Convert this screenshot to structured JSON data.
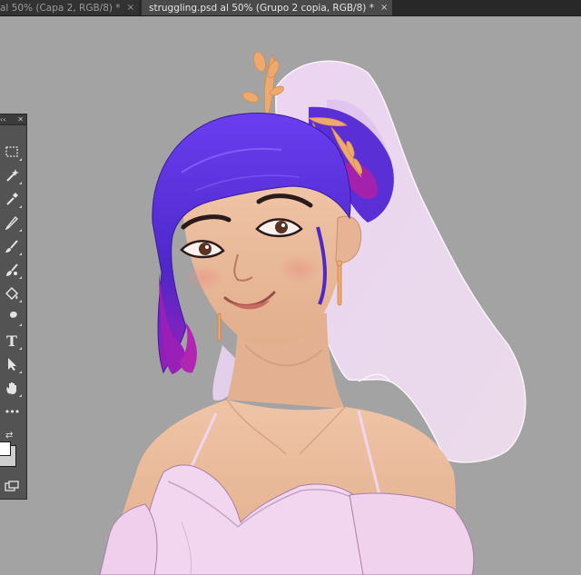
{
  "tabs": [
    {
      "label": "al 50% (Capa 2, RGB/8) *",
      "close": "×",
      "active": false
    },
    {
      "label": "struggling.psd al 50% (Grupo 2 copia, RGB/8) *",
      "close": "×",
      "active": true
    }
  ],
  "toolbar": {
    "collapse_glyph": "‹‹",
    "close_glyph": "✕",
    "type_tool_glyph": "T",
    "more_tools_glyph": "•••",
    "swap_glyph": "⇄",
    "tools": [
      "rectangular-marquee",
      "magic-wand",
      "eyedropper",
      "pencil",
      "brush",
      "mixer-brush",
      "paint-bucket",
      "smudge",
      "type",
      "path-selection",
      "hand",
      "more-tools"
    ],
    "foreground_color": "#ffffff",
    "background_color": "#cfcfcf"
  },
  "canvas": {
    "background_color": "#a3a3a3",
    "artwork": "digital painting"
  },
  "colors": {
    "hair": "#5a2fd6",
    "skin": "#ebbf9f",
    "dress": "#f2d6ef",
    "veil": "#f1d9f5",
    "ornament": "#eeaa6e"
  }
}
